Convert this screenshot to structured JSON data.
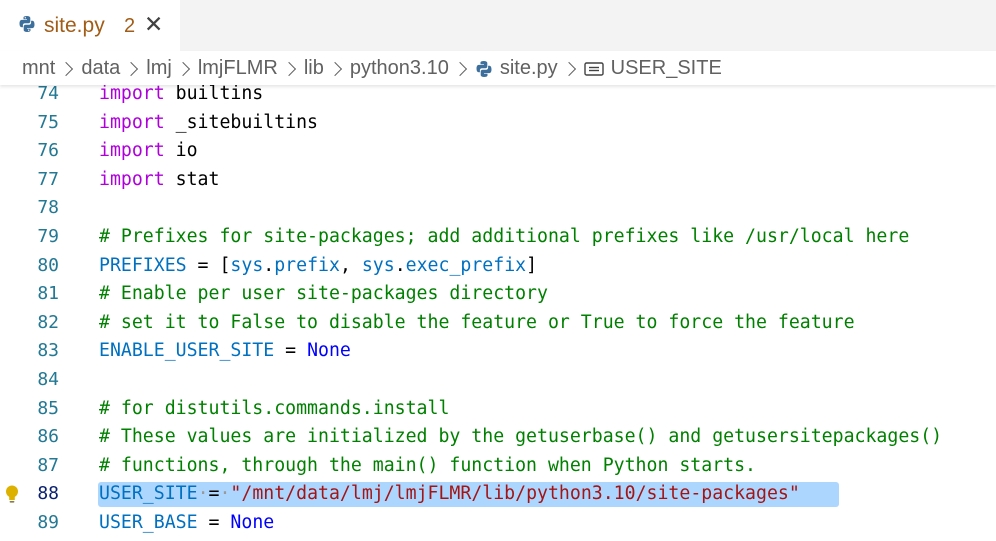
{
  "tab": {
    "title": "site.py",
    "problem_count": "2",
    "close_symbol": "✕",
    "icon": "python-icon"
  },
  "breadcrumb": {
    "items": [
      "mnt",
      "data",
      "lmj",
      "lmjFLMR",
      "lib",
      "python3.10"
    ],
    "file": "site.py",
    "symbol": "USER_SITE"
  },
  "editor": {
    "lines": [
      {
        "n": "74",
        "tokens": [
          [
            "kw",
            "import"
          ],
          [
            "",
            "builtins"
          ]
        ]
      },
      {
        "n": "75",
        "tokens": [
          [
            "kw",
            "import"
          ],
          [
            "",
            "_sitebuiltins"
          ]
        ]
      },
      {
        "n": "76",
        "tokens": [
          [
            "kw",
            "import"
          ],
          [
            "",
            "io"
          ]
        ]
      },
      {
        "n": "77",
        "tokens": [
          [
            "kw",
            "import"
          ],
          [
            "",
            "stat"
          ]
        ]
      },
      {
        "n": "78",
        "tokens": []
      },
      {
        "n": "79",
        "tokens": [
          [
            "cmt",
            "# Prefixes for site-packages; add additional prefixes like /usr/local here"
          ]
        ]
      },
      {
        "n": "80",
        "tokens": [
          [
            "var",
            "PREFIXES"
          ],
          [
            "",
            " = ["
          ],
          [
            "var",
            "sys"
          ],
          [
            "",
            "."
          ],
          [
            "var",
            "prefix"
          ],
          [
            "",
            ", "
          ],
          [
            "var",
            "sys"
          ],
          [
            "",
            "."
          ],
          [
            "var",
            "exec_prefix"
          ],
          [
            "",
            "]"
          ]
        ]
      },
      {
        "n": "81",
        "tokens": [
          [
            "cmt",
            "# Enable per user site-packages directory"
          ]
        ]
      },
      {
        "n": "82",
        "tokens": [
          [
            "cmt",
            "# set it to False to disable the feature or True to force the feature"
          ]
        ]
      },
      {
        "n": "83",
        "tokens": [
          [
            "var",
            "ENABLE_USER_SITE"
          ],
          [
            "",
            " = "
          ],
          [
            "const",
            "None"
          ]
        ]
      },
      {
        "n": "84",
        "tokens": []
      },
      {
        "n": "85",
        "tokens": [
          [
            "cmt",
            "# for distutils.commands.install"
          ]
        ]
      },
      {
        "n": "86",
        "tokens": [
          [
            "cmt",
            "# These values are initialized by the getuserbase() and getusersitepackages()"
          ]
        ]
      },
      {
        "n": "87",
        "tokens": [
          [
            "cmt",
            "# functions, through the main() function when Python starts."
          ]
        ]
      },
      {
        "n": "88",
        "tokens": [
          [
            "var",
            "USER_SITE"
          ],
          [
            "dot",
            "·"
          ],
          [
            "",
            "="
          ],
          [
            "dot",
            "·"
          ],
          [
            "str",
            "\"/mnt/data/lmj/lmjFLMR/lib/python3.10/site-packages\""
          ]
        ],
        "active": true,
        "highlighted": true,
        "lightbulb": true
      },
      {
        "n": "89",
        "tokens": [
          [
            "var",
            "USER_BASE"
          ],
          [
            "",
            " = "
          ],
          [
            "const",
            "None"
          ]
        ]
      }
    ]
  },
  "colors": {
    "keyword": "#af00db",
    "comment": "#008000",
    "variable": "#0070c1",
    "constant": "#0000ff",
    "string": "#a31515",
    "line_number": "#237893",
    "selection": "#add6ff",
    "tab_modified": "#a15c17"
  }
}
